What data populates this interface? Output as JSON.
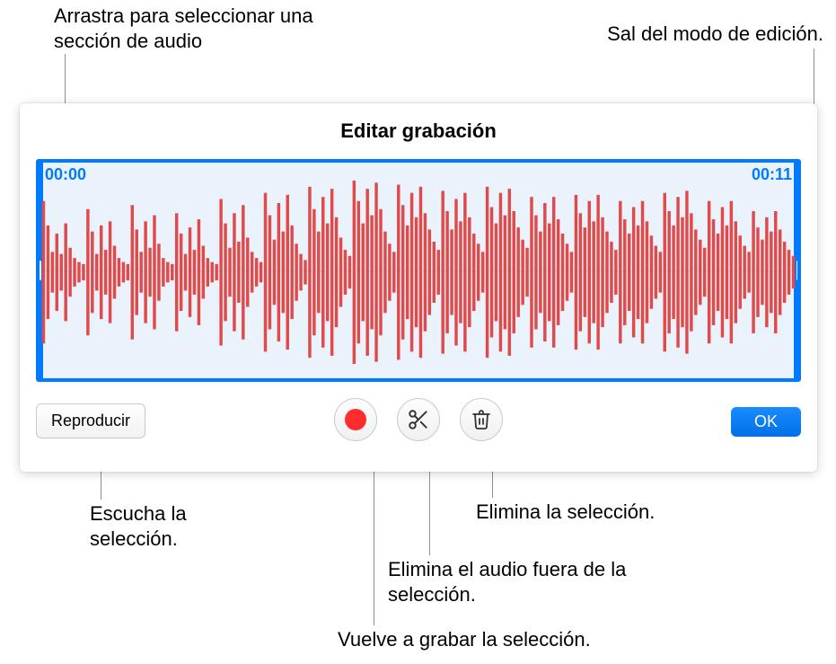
{
  "callouts": {
    "drag_select": "Arrastra para seleccionar una sección de audio",
    "exit_edit": "Sal del modo de edición.",
    "listen": "Escucha la selección.",
    "rerecord": "Vuelve a grabar la selección.",
    "trim_outside": "Elimina el audio fuera de la selección.",
    "delete_selection": "Elimina la selección."
  },
  "panel": {
    "title": "Editar grabación",
    "time_start": "00:00",
    "time_end": "00:11"
  },
  "toolbar": {
    "play_label": "Reproducir",
    "ok_label": "OK"
  },
  "icons": {
    "record": "record-icon",
    "scissors": "scissors-icon",
    "trash": "trash-icon"
  },
  "waveform": {
    "color": "#e04a4a",
    "samples": [
      0.7,
      0.46,
      0.2,
      0.38,
      0.18,
      0.48,
      0.24,
      0.14,
      0.1,
      0.08,
      0.62,
      0.4,
      0.18,
      0.46,
      0.22,
      0.5,
      0.26,
      0.14,
      0.1,
      0.08,
      0.66,
      0.42,
      0.2,
      0.5,
      0.24,
      0.56,
      0.28,
      0.14,
      0.1,
      0.08,
      0.58,
      0.38,
      0.18,
      0.44,
      0.22,
      0.52,
      0.26,
      0.14,
      0.1,
      0.08,
      0.72,
      0.48,
      0.24,
      0.58,
      0.3,
      0.66,
      0.34,
      0.2,
      0.14,
      0.1,
      0.78,
      0.56,
      0.32,
      0.68,
      0.4,
      0.76,
      0.46,
      0.28,
      0.18,
      0.12,
      0.84,
      0.62,
      0.4,
      0.74,
      0.48,
      0.82,
      0.54,
      0.34,
      0.22,
      0.16,
      0.9,
      0.7,
      0.48,
      0.82,
      0.56,
      0.88,
      0.62,
      0.4,
      0.28,
      0.2,
      0.86,
      0.66,
      0.46,
      0.78,
      0.54,
      0.84,
      0.58,
      0.42,
      0.3,
      0.22,
      0.8,
      0.6,
      0.42,
      0.72,
      0.5,
      0.78,
      0.54,
      0.38,
      0.28,
      0.2,
      0.84,
      0.64,
      0.48,
      0.78,
      0.56,
      0.82,
      0.6,
      0.44,
      0.32,
      0.24,
      0.74,
      0.56,
      0.4,
      0.68,
      0.48,
      0.74,
      0.52,
      0.38,
      0.28,
      0.2,
      0.76,
      0.58,
      0.44,
      0.7,
      0.5,
      0.76,
      0.54,
      0.4,
      0.3,
      0.22,
      0.7,
      0.52,
      0.38,
      0.64,
      0.46,
      0.7,
      0.5,
      0.36,
      0.26,
      0.2,
      0.78,
      0.6,
      0.46,
      0.74,
      0.54,
      0.8,
      0.58,
      0.42,
      0.32,
      0.24,
      0.7,
      0.52,
      0.38,
      0.64,
      0.46,
      0.7,
      0.5,
      0.36,
      0.26,
      0.2,
      0.6,
      0.44,
      0.32,
      0.54,
      0.4,
      0.6,
      0.42,
      0.3,
      0.22,
      0.16
    ]
  }
}
